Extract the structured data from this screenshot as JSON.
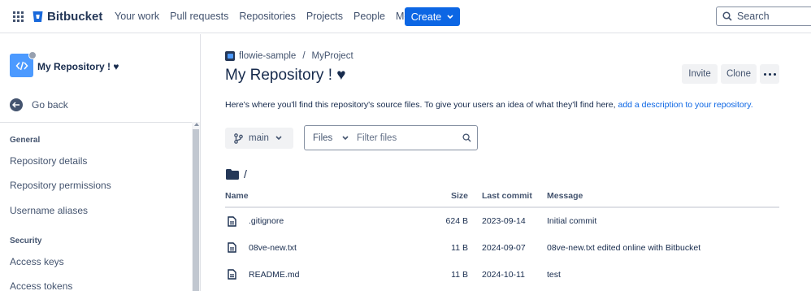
{
  "topnav": {
    "brand": "Bitbucket",
    "items": [
      "Your work",
      "Pull requests",
      "Repositories",
      "Projects",
      "People"
    ],
    "more_label": "More",
    "create_label": "Create",
    "search_placeholder": "Search"
  },
  "sidebar": {
    "repo_name": "My Repository ! ♥",
    "back_label": "Go back",
    "sections": [
      {
        "title": "General",
        "items": [
          "Repository details",
          "Repository permissions",
          "Username aliases"
        ]
      },
      {
        "title": "Security",
        "items": [
          "Access keys",
          "Access tokens"
        ]
      }
    ]
  },
  "main": {
    "breadcrumb": {
      "workspace": "flowie-sample",
      "separator": "/",
      "project": "MyProject"
    },
    "title": "My Repository ! ♥",
    "actions": {
      "invite": "Invite",
      "clone": "Clone"
    },
    "description": {
      "text": "Here's where you'll find this repository's source files. To give your users an idea of what they'll find here, ",
      "link": "add a description to your repository."
    },
    "branch": "main",
    "filter": {
      "type": "Files",
      "placeholder": "Filter files"
    },
    "path": "/",
    "table": {
      "headers": {
        "name": "Name",
        "size": "Size",
        "last_commit": "Last commit",
        "message": "Message"
      },
      "rows": [
        {
          "name": ".gitignore",
          "size": "624 B",
          "date": "2023-09-14",
          "message": "Initial commit"
        },
        {
          "name": "08ve-new.txt",
          "size": "11 B",
          "date": "2024-09-07",
          "message": "08ve-new.txt edited online with Bitbucket"
        },
        {
          "name": "README.md",
          "size": "11 B",
          "date": "2024-10-11",
          "message": "test"
        }
      ]
    }
  },
  "colors": {
    "primary": "#0c66e4",
    "text": "#172b4d",
    "subtle": "#44546f",
    "border": "#dfe1e6"
  }
}
